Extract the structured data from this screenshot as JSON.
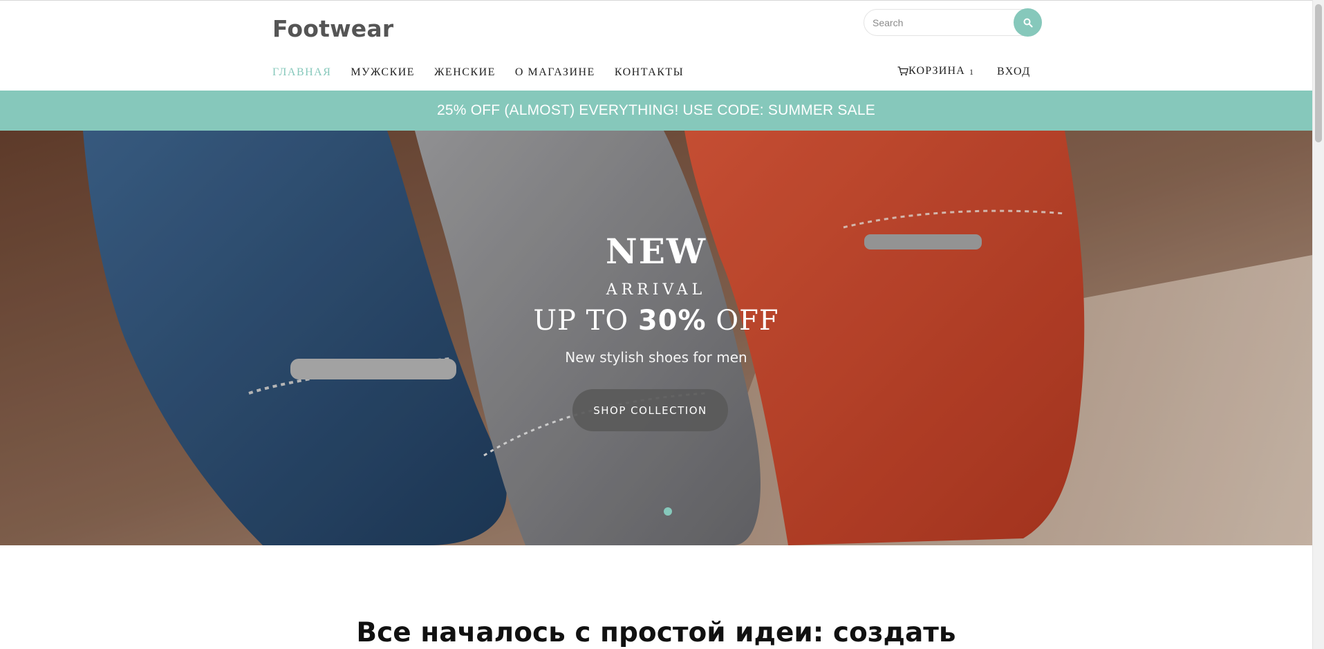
{
  "header": {
    "logo": "Footwear",
    "search_placeholder": "Search",
    "nav": [
      {
        "label": "ГЛАВНАЯ",
        "active": true
      },
      {
        "label": "МУЖСКИЕ",
        "active": false
      },
      {
        "label": "ЖЕНСКИЕ",
        "active": false
      },
      {
        "label": "О МАГАЗИНЕ",
        "active": false
      },
      {
        "label": "КОНТАКТЫ",
        "active": false
      }
    ],
    "cart_label": "КОРЗИНА",
    "cart_count": "1",
    "login_label": "ВХОД"
  },
  "promo": {
    "text": "25% OFF (ALMOST) EVERYTHING! USE CODE: SUMMER SALE"
  },
  "hero": {
    "new": "NEW",
    "arrival": "ARRIVAL",
    "upto_prefix": "UP TO ",
    "upto_value": "30%",
    "upto_suffix": " OFF",
    "subtitle": "New stylish shoes for men",
    "button": "SHOP COLLECTION",
    "slide_count": 1
  },
  "main": {
    "headline": "Все началось с простой идеи: создать"
  },
  "colors": {
    "accent": "#86c8bb",
    "text": "#222222",
    "logo": "#555555",
    "button_bg": "#5a5a5a"
  },
  "icons": {
    "search": "search-icon",
    "cart": "cart-icon"
  }
}
